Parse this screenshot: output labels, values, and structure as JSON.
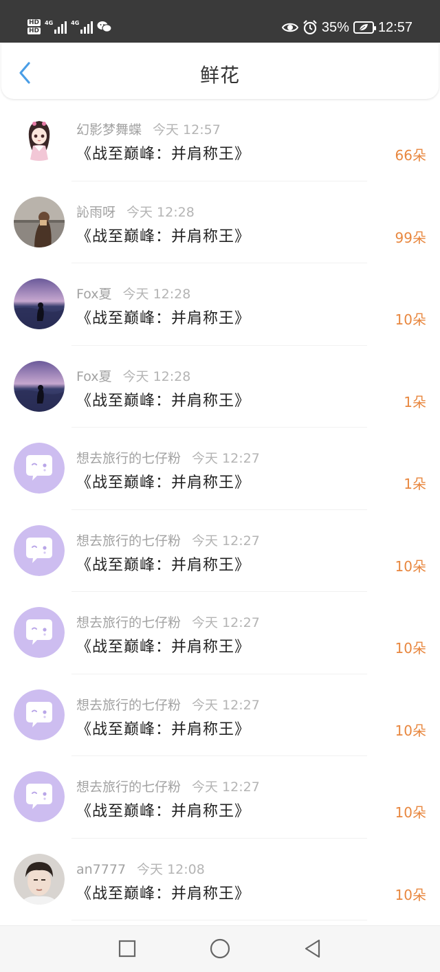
{
  "status_bar": {
    "hd1": "HD",
    "hd2": "HD",
    "net1": "4G",
    "net2": "4G",
    "battery": "35%",
    "time": "12:57",
    "icons": [
      "eye-icon",
      "alarm-icon",
      "wechat-icon",
      "battery-icon"
    ]
  },
  "header": {
    "title": "鲜花",
    "back_icon": "chevron-left-icon"
  },
  "accent_color": "#e8873f",
  "items": [
    {
      "user": "幻影梦舞蝶",
      "time": "今天 12:57",
      "book": "《战至巅峰：并肩称王》",
      "count": "66朵",
      "avatar": "anime-girl"
    },
    {
      "user": "訫雨呀",
      "time": "今天 12:28",
      "book": "《战至巅峰：并肩称王》",
      "count": "99朵",
      "avatar": "photo-person"
    },
    {
      "user": "Fox夏",
      "time": "今天 12:28",
      "book": "《战至巅峰：并肩称王》",
      "count": "10朵",
      "avatar": "photo-sea"
    },
    {
      "user": "Fox夏",
      "time": "今天 12:28",
      "book": "《战至巅峰：并肩称王》",
      "count": "1朵",
      "avatar": "photo-sea"
    },
    {
      "user": "想去旅行的七仔粉",
      "time": "今天 12:27",
      "book": "《战至巅峰：并肩称王》",
      "count": "1朵",
      "avatar": "default-bubble"
    },
    {
      "user": "想去旅行的七仔粉",
      "time": "今天 12:27",
      "book": "《战至巅峰：并肩称王》",
      "count": "10朵",
      "avatar": "default-bubble"
    },
    {
      "user": "想去旅行的七仔粉",
      "time": "今天 12:27",
      "book": "《战至巅峰：并肩称王》",
      "count": "10朵",
      "avatar": "default-bubble"
    },
    {
      "user": "想去旅行的七仔粉",
      "time": "今天 12:27",
      "book": "《战至巅峰：并肩称王》",
      "count": "10朵",
      "avatar": "default-bubble"
    },
    {
      "user": "想去旅行的七仔粉",
      "time": "今天 12:27",
      "book": "《战至巅峰：并肩称王》",
      "count": "10朵",
      "avatar": "default-bubble"
    },
    {
      "user": "an7777",
      "time": "今天 12:08",
      "book": "《战至巅峰：并肩称王》",
      "count": "10朵",
      "avatar": "photo-boy"
    }
  ],
  "nav": {
    "buttons": [
      "recents-square-icon",
      "home-circle-icon",
      "back-triangle-icon"
    ]
  }
}
